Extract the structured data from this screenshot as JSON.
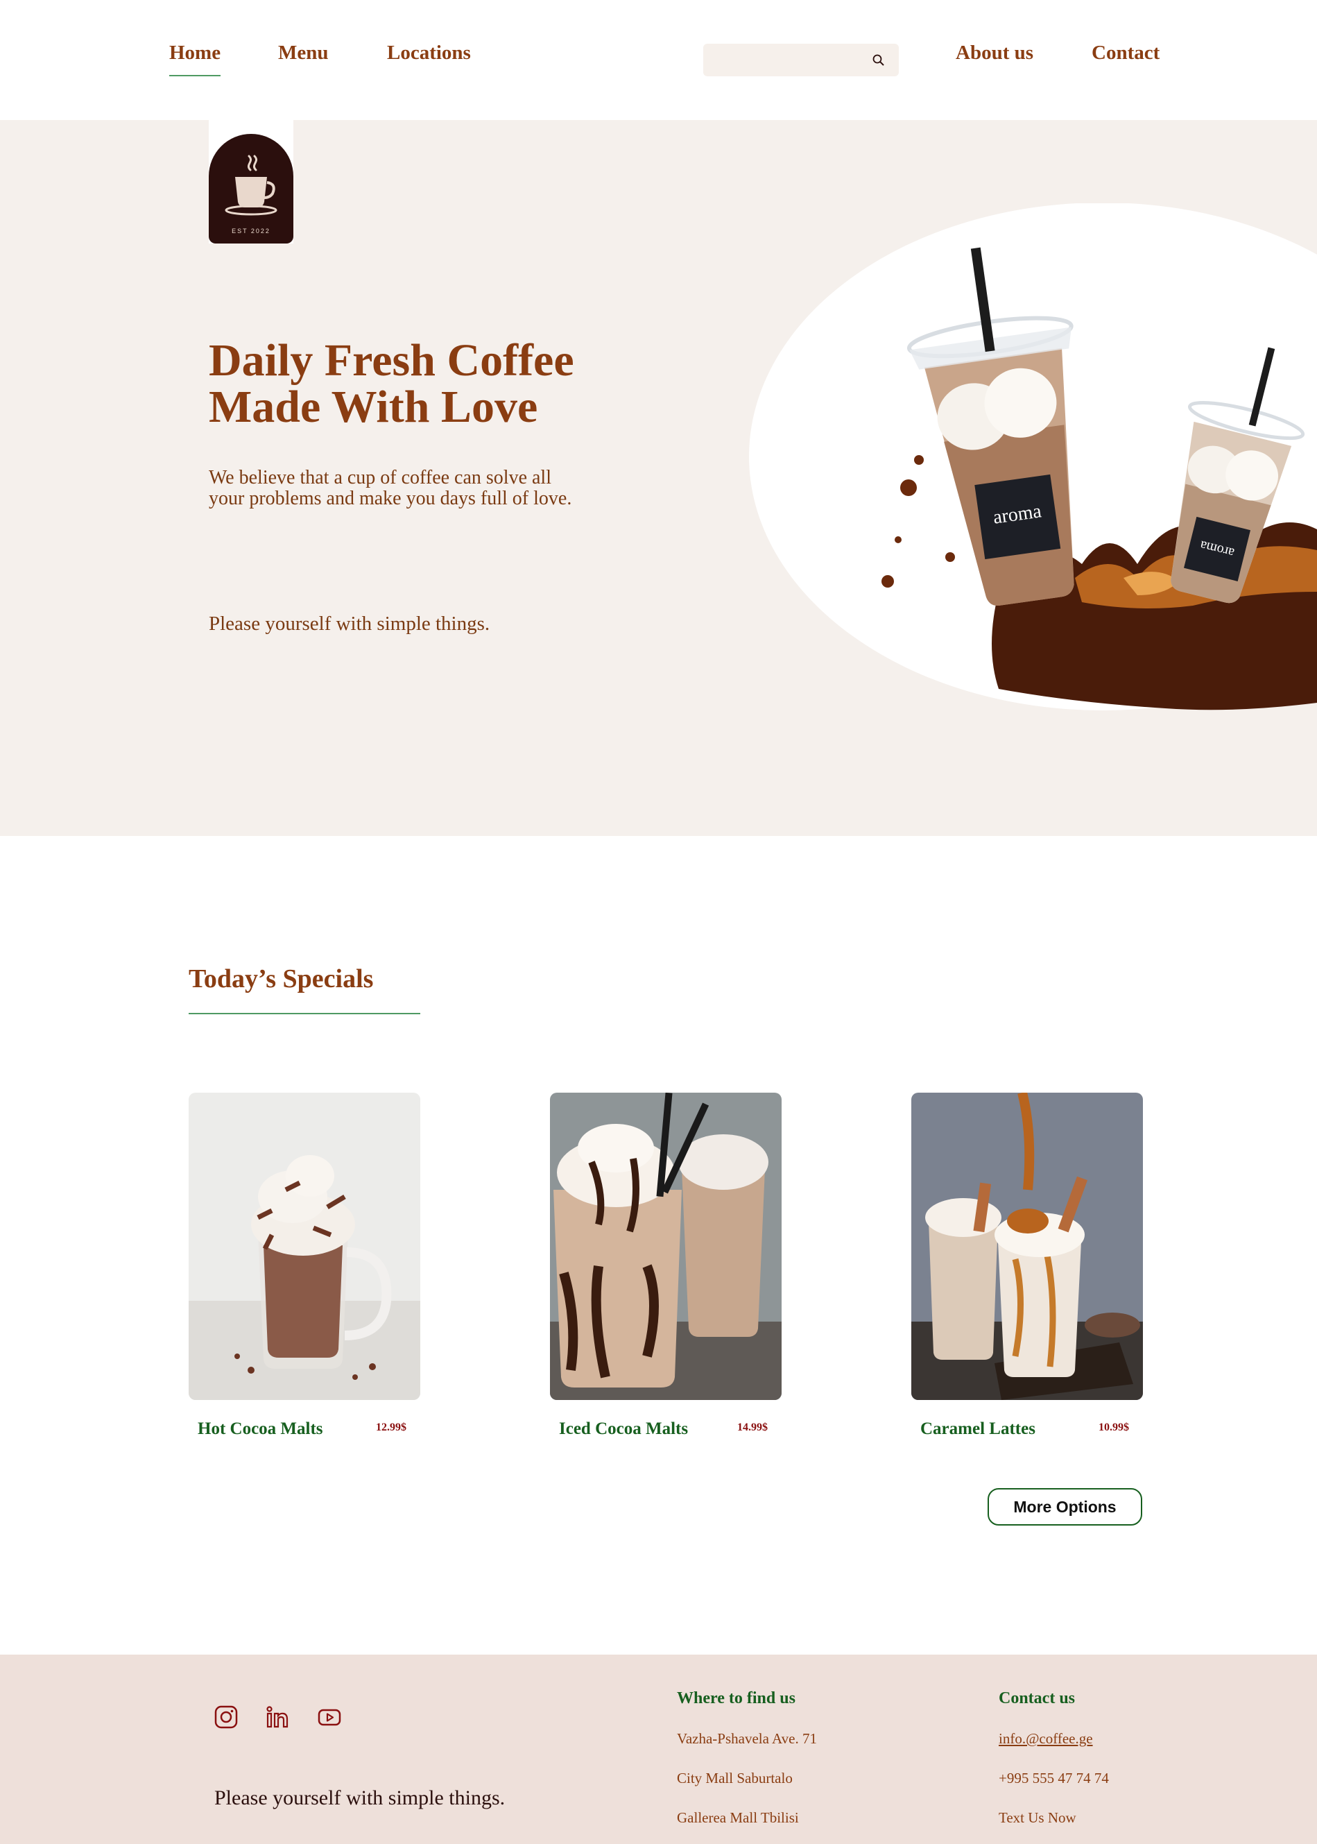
{
  "nav": {
    "items": [
      {
        "label": "Home"
      },
      {
        "label": "Menu"
      },
      {
        "label": "Locations"
      }
    ],
    "right_items": [
      {
        "label": "About us"
      },
      {
        "label": "Contact"
      }
    ],
    "search": {
      "placeholder": "",
      "value": ""
    }
  },
  "hero": {
    "logo_text": "EST 2022",
    "title_line1": "Daily Fresh Coffee",
    "title_line2": "Made With Love",
    "subtitle_line1": "We believe that a cup of coffee can solve all",
    "subtitle_line2": "your problems and make you days full of love.",
    "tagline": "Please yourself with simple things.",
    "cup_brand": "aroma"
  },
  "specials": {
    "title": "Today’s Specials",
    "items": [
      {
        "name": "Hot Cocoa Malts",
        "price": "12.99$"
      },
      {
        "name": "Iced Cocoa Malts",
        "price": "14.99$"
      },
      {
        "name": "Caramel Lattes",
        "price": "10.99$"
      }
    ],
    "more_label": "More Options"
  },
  "footer": {
    "social": [
      "instagram-icon",
      "linkedin-icon",
      "youtube-icon"
    ],
    "tagline": "Please yourself with simple things.",
    "find_us": {
      "heading": "Where to find us",
      "items": [
        "Vazha-Pshavela Ave. 71",
        "City Mall Saburtalo",
        "Gallerea Mall Tbilisi"
      ]
    },
    "contact": {
      "heading": "Contact us",
      "email": "info.@coffee.ge",
      "phone": "+995 555 47 74 74",
      "text_now": "Text Us Now"
    }
  },
  "colors": {
    "brand_brown": "#8a3d12",
    "accent_green": "#175f1f",
    "hero_bg": "#f5f0ec",
    "footer_bg": "#eee0da",
    "price_red": "#8a1010"
  }
}
